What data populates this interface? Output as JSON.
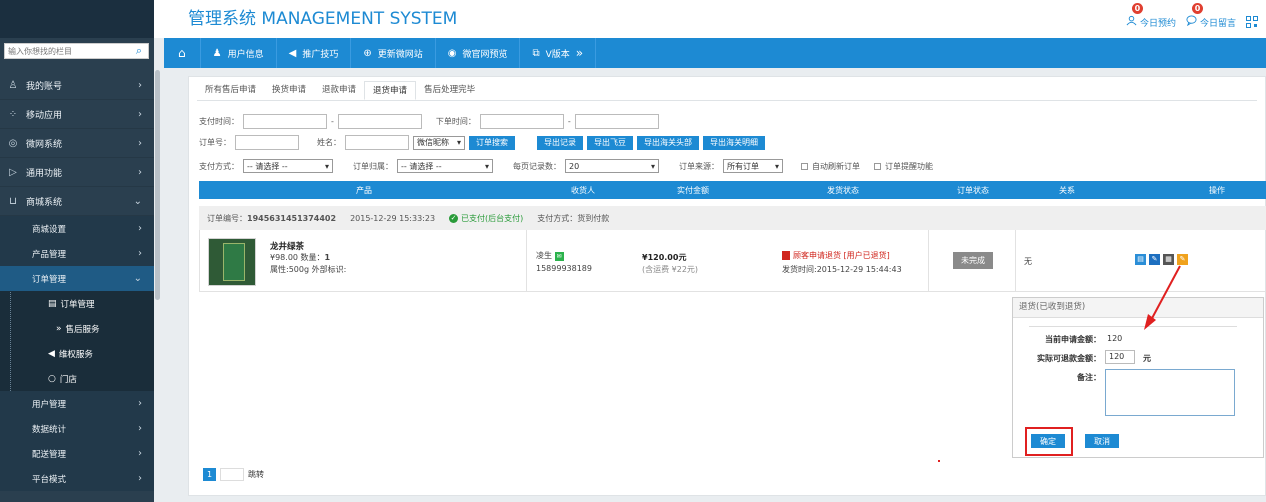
{
  "header": {
    "title": "管理系统 MANAGEMENT SYSTEM",
    "today_booking_count": "0",
    "today_booking_label": "今日预约",
    "today_msg_count": "0",
    "today_msg_label": "今日留言"
  },
  "sidebar": {
    "search_placeholder": "输入你想找的栏目",
    "items": [
      {
        "label": "我的账号"
      },
      {
        "label": "移动应用"
      },
      {
        "label": "微网系统"
      },
      {
        "label": "通用功能"
      },
      {
        "label": "商城系统"
      }
    ],
    "subs": [
      {
        "label": "商城设置"
      },
      {
        "label": "产品管理"
      },
      {
        "label": "订单管理"
      }
    ],
    "leaves": [
      {
        "label": "订单管理"
      },
      {
        "label": "售后服务"
      },
      {
        "label": "维权服务"
      },
      {
        "label": "门店"
      }
    ],
    "subs2": [
      {
        "label": "用户管理"
      },
      {
        "label": "数据统计"
      },
      {
        "label": "配送管理"
      },
      {
        "label": "平台模式"
      }
    ]
  },
  "nav": {
    "user_info": "用户信息",
    "promo": "推广技巧",
    "update_site": "更新微网站",
    "preview": "微官网预览",
    "version": "V版本"
  },
  "tabs": [
    "所有售后申请",
    "换货申请",
    "退款申请",
    "退货申请",
    "售后处理完毕"
  ],
  "filters": {
    "pay_time": "支付时间：",
    "order_time": "下单时间：",
    "order_no": "订单号：",
    "name": "姓名：",
    "nick_select": "微信昵称",
    "search_btn": "订单搜索",
    "export_record": "导出记录",
    "export_feidou": "导出飞豆",
    "export_customs_head": "导出海关头部",
    "export_customs_detail": "导出海关明细",
    "pay_method": "支付方式：",
    "pay_method_val": "-- 请选择 --",
    "order_owner": "订单归属：",
    "order_owner_val": "-- 请选择 --",
    "per_page": "每页记录数：",
    "per_page_val": "20",
    "order_source": "订单来源：",
    "order_source_val": "所有订单",
    "auto_refresh": "自动刷新订单",
    "order_remind": "订单提醒功能"
  },
  "table": {
    "headers": [
      "产品",
      "收货人",
      "实付金额",
      "发货状态",
      "订单状态",
      "关系",
      "操作"
    ]
  },
  "order": {
    "order_no_label": "订单编号：",
    "order_no": "1945631451374402",
    "order_time": "2015-12-29 15:33:23",
    "pay_status": "已支付(后台支付)",
    "pay_method": "支付方式：货到付款",
    "product_name": "龙井绿茶",
    "price_qty": "¥98.00 数量：",
    "qty": "1",
    "attrs": "属性:500g 外部标识:",
    "receiver": "凌生",
    "phone": "15899938189",
    "amount": "¥120.00元",
    "amount_note": "(含运费 ¥22元)",
    "ship_status": "顾客申请退货 [用户已退货]",
    "ship_time": "发货时间:2015-12-29 15:44:43",
    "order_state": "未完成",
    "relation": "无"
  },
  "dialog": {
    "title": "退货(已收到退货)",
    "current_label": "当前申请金额：",
    "current_value": "120",
    "refund_label": "实际可退款金额：",
    "refund_value": "120",
    "unit": "元",
    "remark_label": "备注：",
    "confirm": "确定",
    "cancel": "取消"
  },
  "pager": {
    "current": "1",
    "jump": "跳转"
  }
}
